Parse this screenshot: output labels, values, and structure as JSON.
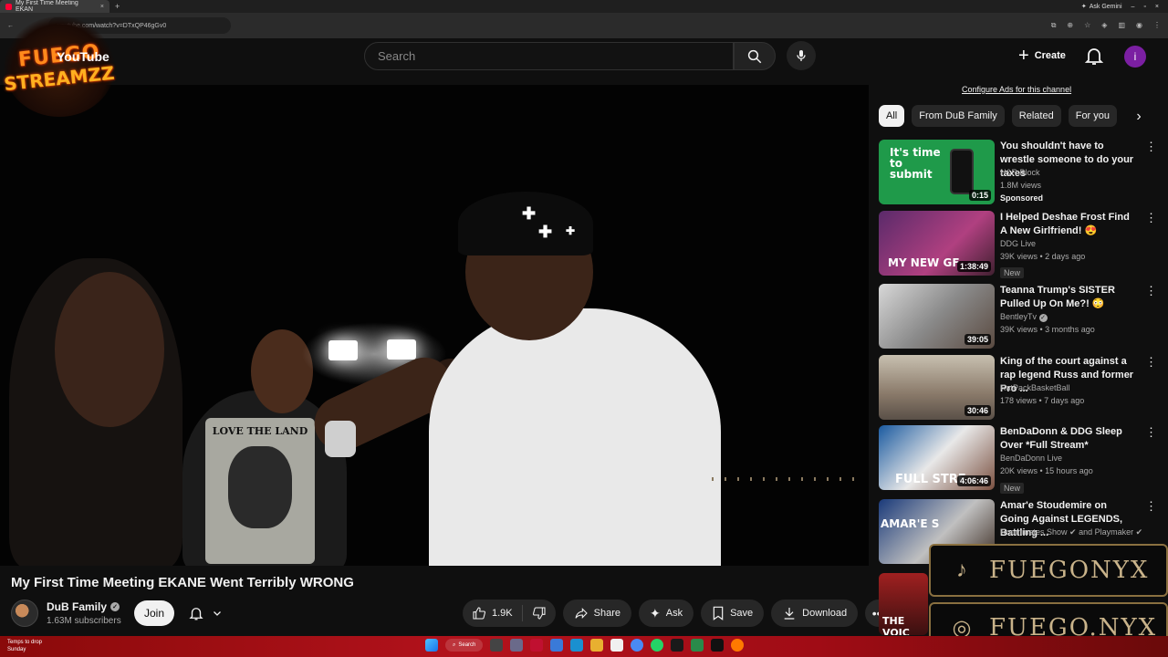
{
  "browser": {
    "tab_title": "My First Time Meeting EKAN",
    "url": "youtube.com/watch?v=DTxQP46gGv0",
    "gemini_label": "Ask Gemini"
  },
  "overlay_logo": {
    "line1": "FUEGO",
    "line2": "STREAMZZ",
    "yt_word": "YouTube"
  },
  "header": {
    "search_placeholder": "Search",
    "create_label": "Create",
    "user_initial": "i"
  },
  "video": {
    "title": "My First Time Meeting EKANE Went Terribly WRONG",
    "channel": "DuB Family",
    "subscribers": "1.63M subscribers",
    "join_label": "Join",
    "likes": "1.9K",
    "share_label": "Share",
    "ask_label": "Ask",
    "save_label": "Save",
    "download_label": "Download",
    "shirt_text": "LOVE THE LAND"
  },
  "sidebar": {
    "ads_config": "Configure Ads for this channel",
    "chips": [
      "All",
      "From DuB Family",
      "Related",
      "For you"
    ],
    "recommendations": [
      {
        "title": "You shouldn't have to wrestle someone to do your taxes",
        "channel": "H&R Block",
        "meta": "1.8M views",
        "badge": "Sponsored",
        "duration": "0:15",
        "thumb_text": "It's time to submit",
        "verified": false
      },
      {
        "title": "I Helped Deshae Frost Find A New Girlfriend! 😍",
        "channel": "DDG Live",
        "meta": "39K views • 2 days ago",
        "badge": "New",
        "duration": "1:38:49",
        "thumb_text": "MY NEW GF",
        "verified": false
      },
      {
        "title": "Teanna Trump's SISTER Pulled Up On Me?! 😳",
        "channel": "BentleyTv",
        "meta": "39K views • 3 months ago",
        "badge": "",
        "duration": "39:05",
        "thumb_text": "",
        "verified": true
      },
      {
        "title": "King of the court against a rap legend Russ and former Pro ...",
        "channel": "RatPackBasketBall",
        "meta": "178 views • 7 days ago",
        "badge": "",
        "duration": "30:46",
        "thumb_text": "",
        "verified": false
      },
      {
        "title": "BenDaDonn & DDG Sleep Over *Full Stream*",
        "channel": "BenDaDonn Live",
        "meta": "20K views • 15 hours ago",
        "badge": "New",
        "duration": "4:06:46",
        "thumb_text": "FULL STRE",
        "verified": false
      },
      {
        "title": "Amar'e Stoudemire on Going Against LEGENDS, Battling ...",
        "channel": "Roommates Show ✔ and Playmaker ✔",
        "meta": "",
        "badge": "",
        "duration": "",
        "thumb_text": "AMAR'E S",
        "verified": false
      },
      {
        "title": "",
        "channel": "",
        "meta": "",
        "badge": "",
        "duration": "",
        "thumb_text": "THE VOIC",
        "verified": false
      }
    ]
  },
  "stream_overlay": {
    "tiktok": "FUEGONYX",
    "instagram": "FUEGO.NYX"
  },
  "taskbar": {
    "weather_line1": "Temps to drop",
    "weather_line2": "Sunday",
    "search_label": "Search"
  },
  "colors": {
    "background": "#0f0f0f",
    "accent_red": "#ff0033",
    "taskbar": "#b3121c",
    "overlay_gold": "#c9b38a"
  }
}
